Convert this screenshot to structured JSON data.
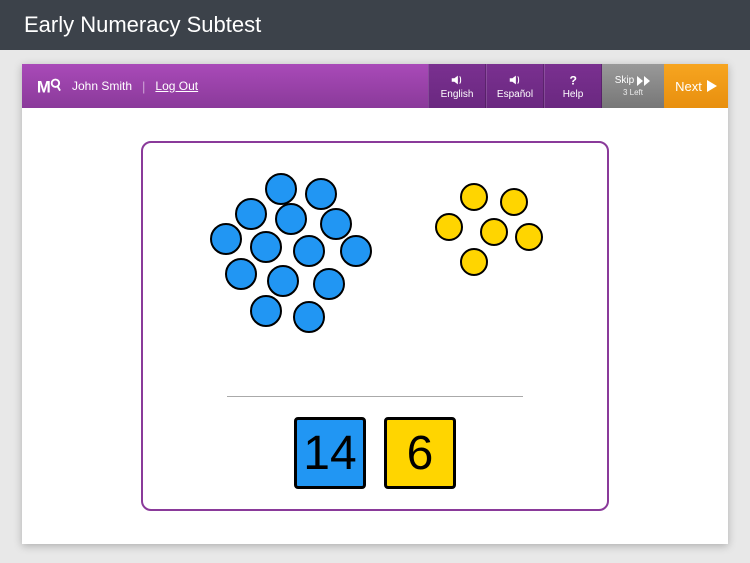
{
  "title": "Early Numeracy Subtest",
  "user": {
    "name": "John Smith",
    "logout": "Log Out"
  },
  "toolbar": {
    "english": "English",
    "espanol": "Español",
    "help": "Help",
    "skip": "Skip",
    "skip_sub": "3 Left",
    "next": "Next"
  },
  "answers": {
    "left": "14",
    "right": "6"
  },
  "colors": {
    "purple": "#8a3a9a",
    "blue": "#2196f3",
    "yellow": "#ffd500",
    "orange": "#e88f0e"
  },
  "dot_clusters": {
    "blue_count": 14,
    "yellow_count": 6
  }
}
